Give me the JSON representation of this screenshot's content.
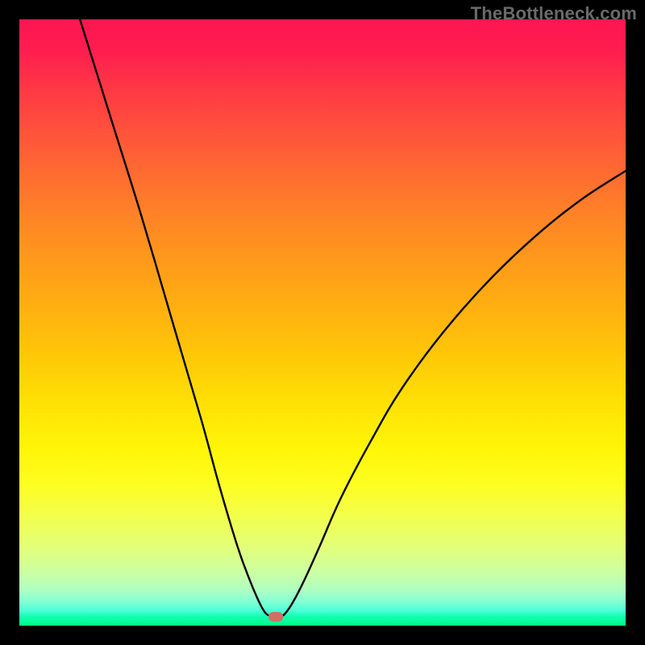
{
  "watermark": "TheBottleneck.com",
  "chart_data": {
    "type": "line",
    "title": "",
    "xlabel": "",
    "ylabel": "",
    "xlim": [
      0,
      100
    ],
    "ylim": [
      0,
      100
    ],
    "grid": false,
    "marker": {
      "x_pct": 42.3,
      "y_pct": 98.6
    },
    "series": [
      {
        "name": "curve",
        "points": [
          {
            "x_pct": 10.0,
            "y_pct": 0.0
          },
          {
            "x_pct": 15.0,
            "y_pct": 16.0
          },
          {
            "x_pct": 20.0,
            "y_pct": 32.0
          },
          {
            "x_pct": 25.0,
            "y_pct": 49.0
          },
          {
            "x_pct": 30.0,
            "y_pct": 66.0
          },
          {
            "x_pct": 33.0,
            "y_pct": 77.0
          },
          {
            "x_pct": 36.0,
            "y_pct": 87.0
          },
          {
            "x_pct": 38.0,
            "y_pct": 92.5
          },
          {
            "x_pct": 39.5,
            "y_pct": 96.0
          },
          {
            "x_pct": 40.5,
            "y_pct": 97.8
          },
          {
            "x_pct": 41.5,
            "y_pct": 98.4
          },
          {
            "x_pct": 43.2,
            "y_pct": 98.4
          },
          {
            "x_pct": 44.0,
            "y_pct": 97.8
          },
          {
            "x_pct": 45.2,
            "y_pct": 96.0
          },
          {
            "x_pct": 47.0,
            "y_pct": 92.5
          },
          {
            "x_pct": 49.5,
            "y_pct": 87.0
          },
          {
            "x_pct": 53.0,
            "y_pct": 79.0
          },
          {
            "x_pct": 58.0,
            "y_pct": 69.5
          },
          {
            "x_pct": 63.0,
            "y_pct": 61.0
          },
          {
            "x_pct": 70.0,
            "y_pct": 51.5
          },
          {
            "x_pct": 78.0,
            "y_pct": 42.5
          },
          {
            "x_pct": 86.0,
            "y_pct": 35.0
          },
          {
            "x_pct": 93.0,
            "y_pct": 29.5
          },
          {
            "x_pct": 100.0,
            "y_pct": 25.0
          }
        ]
      }
    ],
    "background_gradient": {
      "type": "vertical",
      "stops": [
        {
          "offset": 0.0,
          "color": "#fe1651"
        },
        {
          "offset": 0.32,
          "color": "#ff8227"
        },
        {
          "offset": 0.63,
          "color": "#ffe004"
        },
        {
          "offset": 0.82,
          "color": "#f3ff4d"
        },
        {
          "offset": 0.96,
          "color": "#84ffd5"
        },
        {
          "offset": 1.0,
          "color": "#00fd84"
        }
      ]
    }
  }
}
